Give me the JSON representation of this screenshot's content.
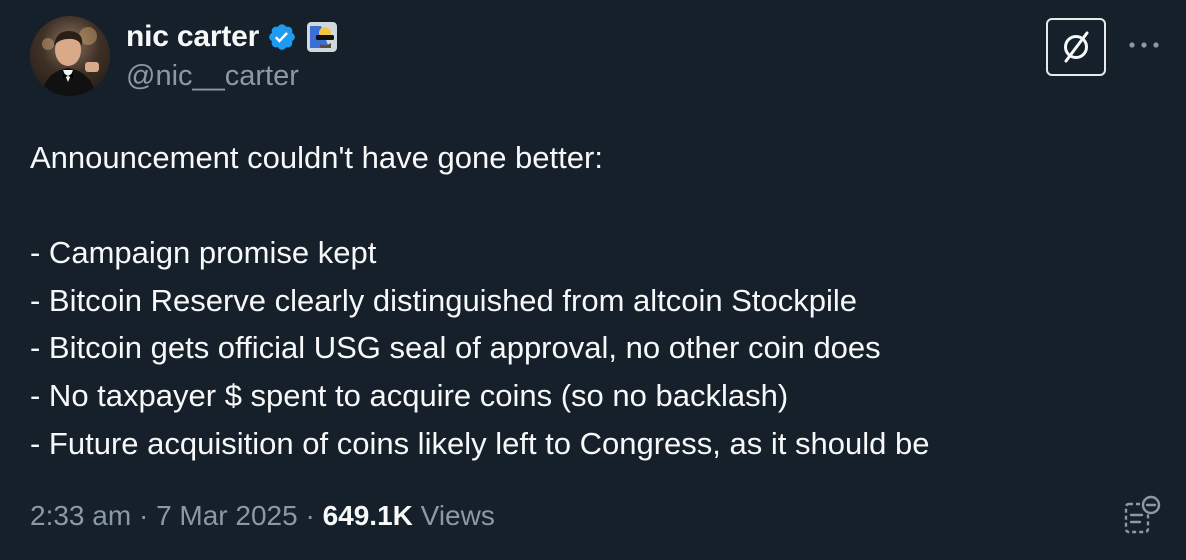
{
  "author": {
    "display_name": "nic carter",
    "handle": "@nic__carter",
    "verified_icon": "verified-badge-icon",
    "affiliation_icon": "affiliation-badge-icon"
  },
  "tweet": {
    "lines": [
      "Announcement couldn't have gone better:",
      "",
      "- Campaign promise kept",
      "- Bitcoin Reserve clearly distinguished from altcoin Stockpile",
      "- Bitcoin gets official USG seal of approval, no other coin does",
      "- No taxpayer $ spent to acquire coins (so no backlash)",
      "- Future acquisition of coins likely left to Congress, as it should be"
    ]
  },
  "meta": {
    "time": "2:33 am",
    "separator": " · ",
    "date": "7 Mar 2025",
    "views_count": "649.1K",
    "views_label": " Views"
  },
  "icons": {
    "brand": "brand-logo-icon",
    "more": "more-options-icon",
    "notes": "community-notes-icon"
  },
  "colors": {
    "background": "#15202b",
    "text": "#f7f9f9",
    "secondary": "#8b98a5",
    "verified": "#1d9bf0"
  }
}
